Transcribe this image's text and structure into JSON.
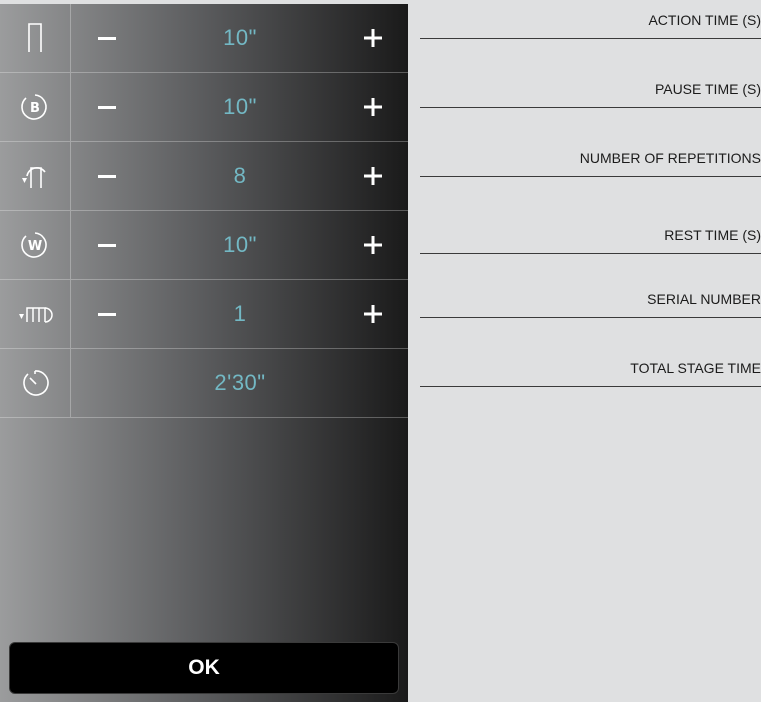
{
  "panel": {
    "rows": [
      {
        "icon": "action-time-icon",
        "value": "10\"",
        "has_stepper": true
      },
      {
        "icon": "pause-time-icon",
        "value": "10\"",
        "has_stepper": true
      },
      {
        "icon": "repetitions-icon",
        "value": "8",
        "has_stepper": true
      },
      {
        "icon": "rest-time-icon",
        "value": "10\"",
        "has_stepper": true
      },
      {
        "icon": "series-icon",
        "value": "1",
        "has_stepper": true
      },
      {
        "icon": "total-time-icon",
        "value": "2'30\"",
        "has_stepper": false
      }
    ],
    "ok_label": "OK"
  },
  "labels": [
    "ACTION TIME (S)",
    "PAUSE TIME (S)",
    "NUMBER OF REPETITIONS",
    "REST TIME (S)",
    "SERIAL NUMBER",
    "TOTAL STAGE TIME"
  ],
  "colors": {
    "value_text": "#73b8c4",
    "page_background": "#dfe0e1",
    "ok_button": "#000000"
  }
}
